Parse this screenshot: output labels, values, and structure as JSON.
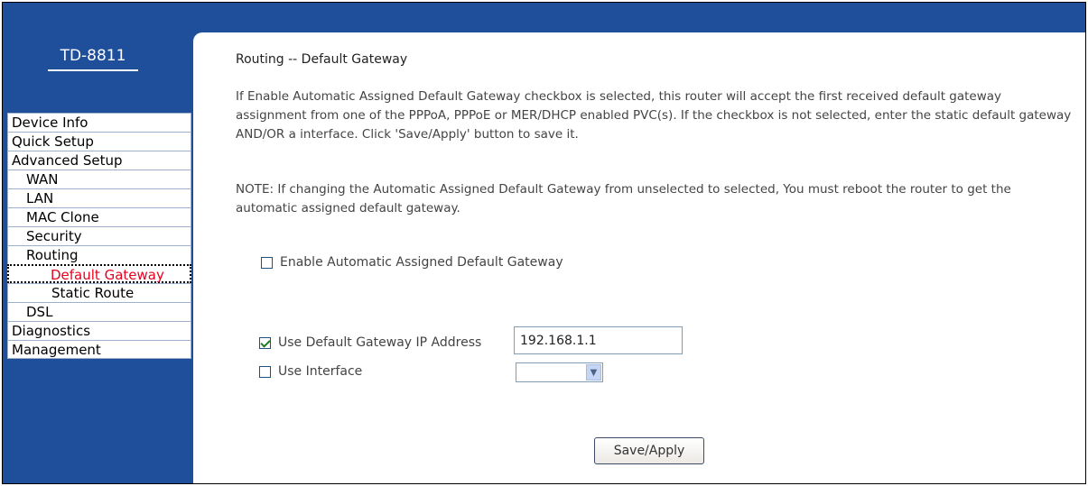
{
  "header": {
    "model": "TD-8811"
  },
  "nav": [
    {
      "label": "Device Info",
      "level": 1
    },
    {
      "label": "Quick Setup",
      "level": 1
    },
    {
      "label": "Advanced Setup",
      "level": 1
    },
    {
      "label": "WAN",
      "level": 2
    },
    {
      "label": "LAN",
      "level": 2
    },
    {
      "label": "MAC Clone",
      "level": 2
    },
    {
      "label": "Security",
      "level": 2
    },
    {
      "label": "Routing",
      "level": 2
    },
    {
      "label": "Default Gateway",
      "level": 3,
      "active": true
    },
    {
      "label": "Static Route",
      "level": 3
    },
    {
      "label": "DSL",
      "level": 2
    },
    {
      "label": "Diagnostics",
      "level": 1
    },
    {
      "label": "Management",
      "level": 1
    }
  ],
  "page": {
    "title": "Routing -- Default Gateway",
    "description": "If Enable Automatic Assigned Default Gateway checkbox is selected, this router will accept the first received default gateway assignment from one of the PPPoA, PPPoE or MER/DHCP enabled PVC(s). If the checkbox is not selected, enter the static default gateway AND/OR a interface. Click 'Save/Apply' button to save it.",
    "note": "NOTE: If changing the Automatic Assigned Default Gateway from unselected to selected, You must reboot the router to get the automatic assigned default gateway."
  },
  "form": {
    "auto_label": "Enable Automatic Assigned Default Gateway",
    "auto_checked": false,
    "use_ip_label": "Use Default Gateway IP Address",
    "use_ip_checked": true,
    "ip_value": "192.168.1.1",
    "use_interface_label": "Use Interface",
    "use_interface_checked": false,
    "interface_value": "",
    "save_label": "Save/Apply"
  },
  "colors": {
    "brand_blue": "#1f4e9a",
    "active_nav_text": "#e8001c"
  }
}
